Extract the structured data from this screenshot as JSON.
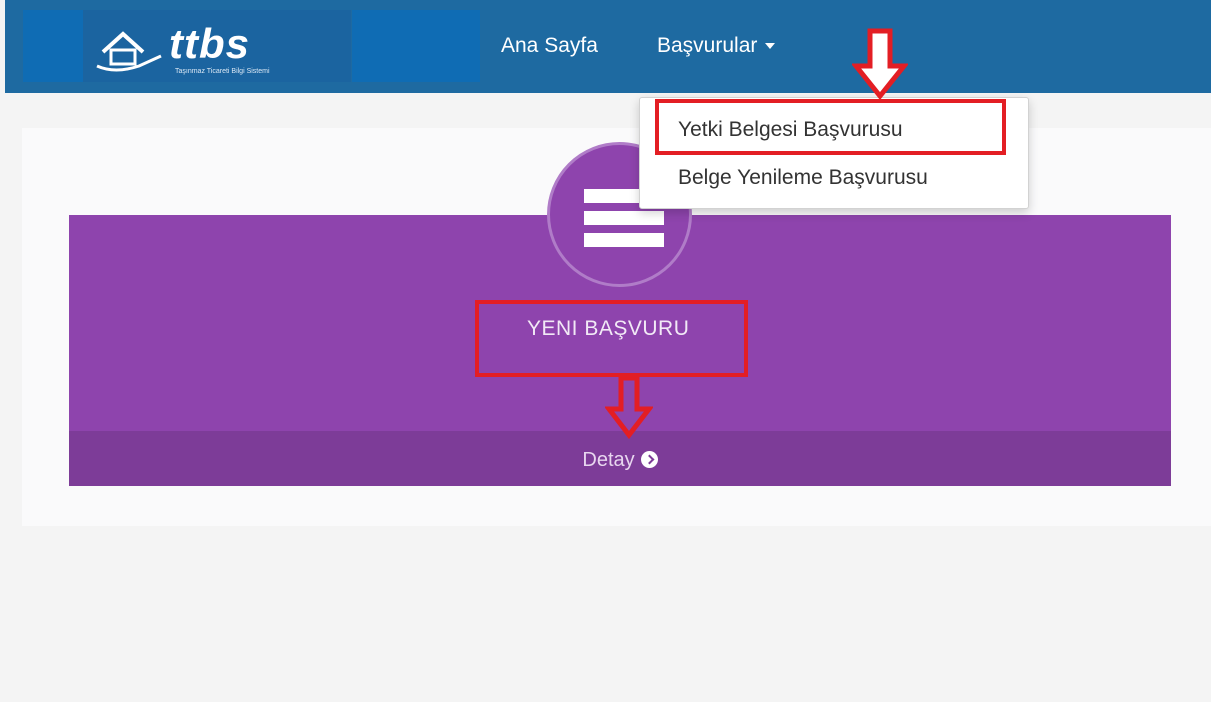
{
  "navbar": {
    "logo_text": "ttbs",
    "logo_subtitle": "Taşınmaz Ticareti Bilgi Sistemi",
    "links": [
      {
        "label": "Ana Sayfa"
      },
      {
        "label": "Başvurular"
      }
    ]
  },
  "dropdown": {
    "items": [
      {
        "label": "Yetki Belgesi Başvurusu"
      },
      {
        "label": "Belge Yenileme Başvurusu"
      }
    ]
  },
  "card": {
    "title": "YENI BAŞVURU",
    "footer_label": "Detay",
    "icon": "server-icon"
  },
  "colors": {
    "navbar": "#1e6aa1",
    "card_purple": "#8e44ad",
    "card_footer": "#7d3c98",
    "annotation_red": "#e31e24"
  }
}
